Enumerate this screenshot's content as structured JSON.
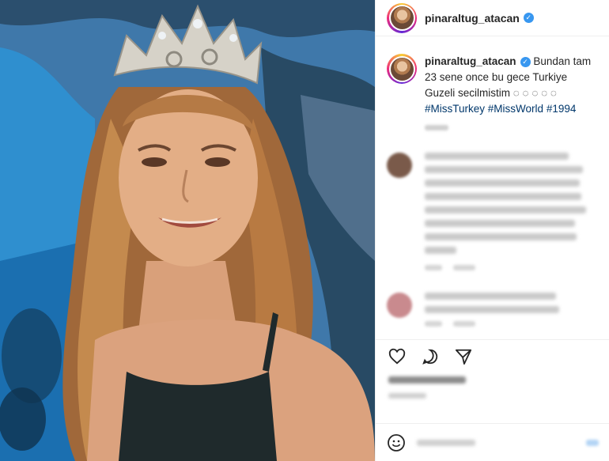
{
  "post": {
    "username": "pinaraltug_atacan",
    "verified_mark": "✓",
    "caption": {
      "username": "pinaraltug_atacan",
      "text": "Bundan tam 23 sene once bu gece Turkiye Guzeli secilmistim",
      "emojis": "◌ ◌ ◌ ◌ ◌",
      "hashtags": [
        "#MissTurkey",
        "#MissWorld",
        "#1994"
      ]
    }
  },
  "icons": {
    "like": "heart-icon",
    "comment": "comment-icon",
    "share": "share-icon",
    "emoji": "emoji-icon"
  },
  "colors": {
    "hashtag": "#00376b",
    "verified": "#3897f0",
    "story_ring_start": "#f9ce34",
    "story_ring_end": "#6228d7"
  }
}
